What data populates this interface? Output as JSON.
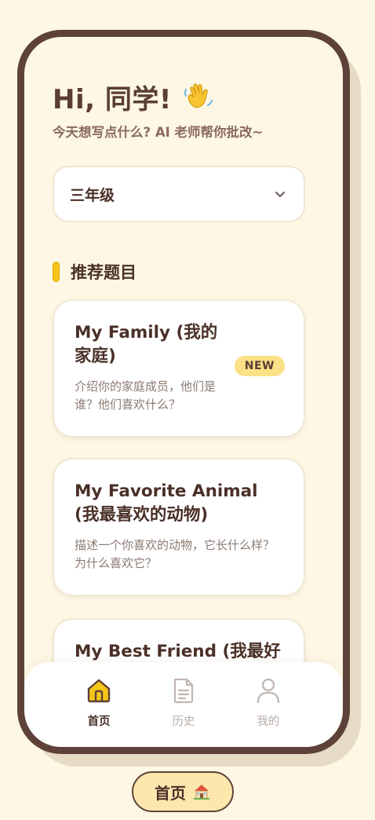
{
  "header": {
    "greeting": "Hi, 同学!",
    "greeting_icon": "waving-hand-icon",
    "subtitle": "今天想写点什么? AI 老师帮你批改~"
  },
  "grade_select": {
    "value": "三年级",
    "icon": "chevron-down-icon"
  },
  "section": {
    "title": "推荐题目"
  },
  "topics": [
    {
      "title": "My Family (我的家庭)",
      "description": "介绍你的家庭成员，他们是谁？他们喜欢什么？",
      "badge": "NEW"
    },
    {
      "title": "My Favorite Animal (我最喜欢的动物)",
      "description": "描述一个你喜欢的动物，它长什么样？为什么喜欢它？"
    },
    {
      "title": "My Best Friend (我最好",
      "description": ""
    }
  ],
  "bottom_nav": {
    "items": [
      {
        "label": "首页",
        "icon": "home-icon",
        "active": true
      },
      {
        "label": "历史",
        "icon": "document-icon",
        "active": false
      },
      {
        "label": "我的",
        "icon": "user-icon",
        "active": false
      }
    ]
  },
  "page_caption": {
    "label": "首页",
    "icon": "house-emoji-icon"
  },
  "colors": {
    "background": "#fdf7e4",
    "phone_frame": "#5e4239",
    "accent_yellow": "#f5c518",
    "badge_bg": "#fbe086",
    "text_dark": "#4a3028",
    "text_muted": "#8a7a72"
  }
}
